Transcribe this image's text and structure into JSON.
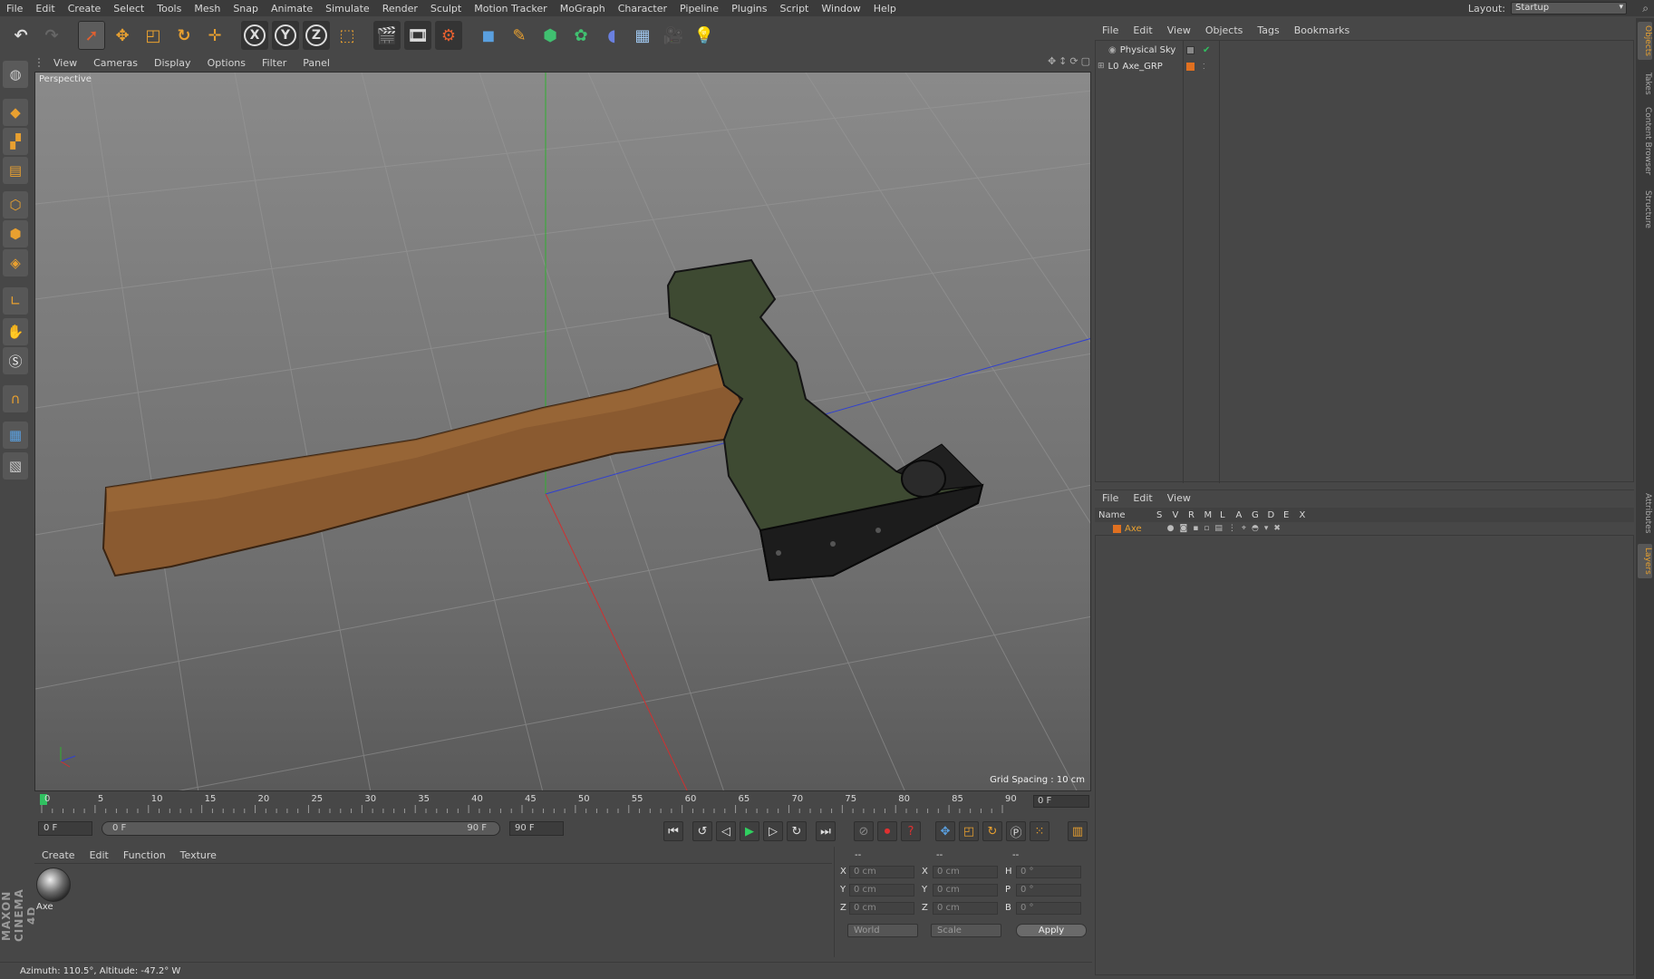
{
  "menubar": [
    "File",
    "Edit",
    "Create",
    "Select",
    "Tools",
    "Mesh",
    "Snap",
    "Animate",
    "Simulate",
    "Render",
    "Sculpt",
    "Motion Tracker",
    "MoGraph",
    "Character",
    "Pipeline",
    "Plugins",
    "Script",
    "Window",
    "Help"
  ],
  "layout": {
    "label": "Layout:",
    "value": "Startup"
  },
  "toolbar": {
    "axis_x": "X",
    "axis_y": "Y",
    "axis_z": "Z",
    "icons": [
      "undo-icon",
      "redo-icon",
      "live-select-icon",
      "move-icon",
      "scale-icon",
      "rotate-icon",
      "add-icon",
      "x-axis-icon",
      "y-axis-icon",
      "z-axis-icon",
      "coordinate-system-icon",
      "render-view-icon",
      "render-picture-viewer-icon",
      "render-settings-icon",
      "cube-icon",
      "pen-icon",
      "subdivision-icon",
      "cloner-icon",
      "deformer-icon",
      "floor-icon",
      "camera-icon",
      "light-icon"
    ]
  },
  "viewport": {
    "menu": [
      "View",
      "Cameras",
      "Display",
      "Options",
      "Filter",
      "Panel"
    ],
    "label": "Perspective",
    "grid_spacing": "Grid Spacing : 10 cm"
  },
  "timeline": {
    "ticks": [
      "0",
      "5",
      "10",
      "15",
      "20",
      "25",
      "30",
      "35",
      "40",
      "45",
      "50",
      "55",
      "60",
      "65",
      "70",
      "75",
      "80",
      "85",
      "90"
    ],
    "current_frame": "0 F",
    "start_field": "0 F",
    "range_start": "0 F",
    "range_end": "90 F",
    "end_field": "90 F"
  },
  "material_manager": {
    "menu": [
      "Create",
      "Edit",
      "Function",
      "Texture"
    ],
    "materials": [
      {
        "name": "Axe"
      }
    ]
  },
  "coordinates": {
    "header_pos": "--",
    "header_size": "--",
    "header_rot": "--",
    "rows": [
      {
        "axis": "X",
        "pos": "0 cm",
        "size_axis": "X",
        "size": "0 cm",
        "rot_axis": "H",
        "rot": "0 °"
      },
      {
        "axis": "Y",
        "pos": "0 cm",
        "size_axis": "Y",
        "size": "0 cm",
        "rot_axis": "P",
        "rot": "0 °"
      },
      {
        "axis": "Z",
        "pos": "0 cm",
        "size_axis": "Z",
        "size": "0 cm",
        "rot_axis": "B",
        "rot": "0 °"
      }
    ],
    "coord_system": "World",
    "mode": "Scale",
    "apply": "Apply"
  },
  "status": "Azimuth: 110.5°, Altitude: -47.2°  W",
  "object_manager": {
    "menu": [
      "File",
      "Edit",
      "View",
      "Objects",
      "Tags",
      "Bookmarks"
    ],
    "objects": [
      {
        "name": "Physical Sky"
      },
      {
        "name": "Axe_GRP"
      }
    ]
  },
  "layer_manager": {
    "menu": [
      "File",
      "Edit",
      "View"
    ],
    "columns": [
      "Name",
      "S",
      "V",
      "R",
      "M",
      "L",
      "A",
      "G",
      "D",
      "E",
      "X"
    ],
    "layers": [
      {
        "name": "Axe",
        "color": "#e07020"
      }
    ]
  },
  "right_tabs": [
    "Objects",
    "Takes",
    "Content Browser",
    "Structure",
    "Attributes",
    "Layers"
  ],
  "logo": "MAXON CINEMA 4D",
  "colors": {
    "accent": "#e8a030",
    "layer_orange": "#e07020",
    "x_axis": "#d03030",
    "y_axis": "#30b030",
    "z_axis": "#3040d0"
  }
}
